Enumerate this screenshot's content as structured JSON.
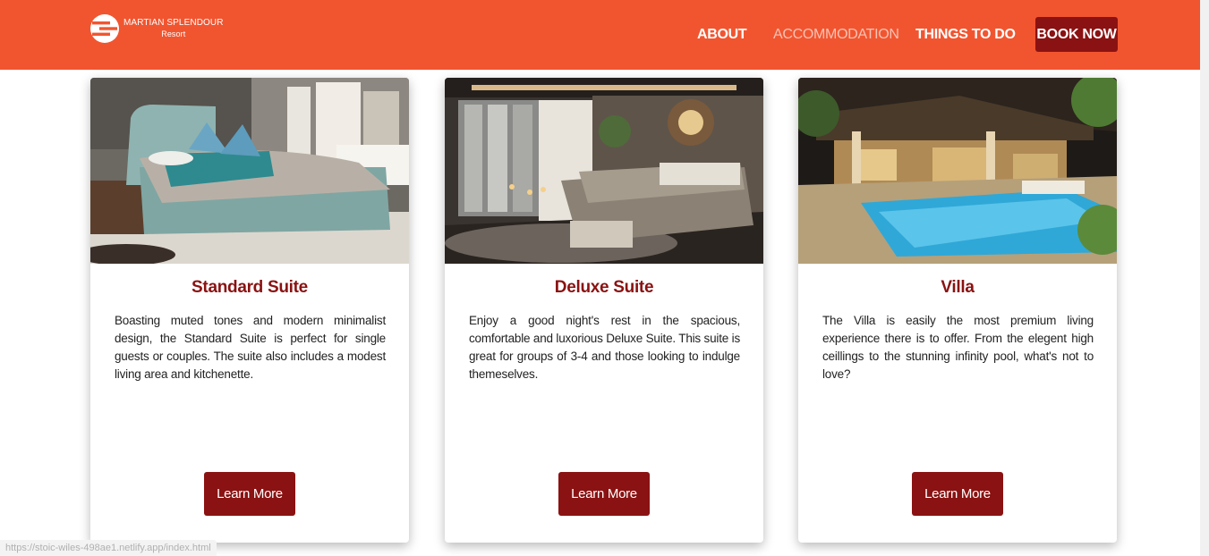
{
  "brand": {
    "name": "MARTIAN SPLENDOUR",
    "sub": "Resort"
  },
  "nav": {
    "items": [
      {
        "label": "ABOUT",
        "active": false
      },
      {
        "label": "ACCOMMODATION",
        "active": true
      },
      {
        "label": "THINGS TO DO",
        "active": false
      }
    ],
    "cta": "BOOK NOW"
  },
  "colors": {
    "header": "#f15530",
    "accent": "#8a1212",
    "nav_active": "#f7c2b4"
  },
  "cards": [
    {
      "title": "Standard Suite",
      "description": "Boasting muted tones and modern minimalist design, the Standard Suite is perfect for single guests or couples. The suite also includes a modest living area and kitchenette.",
      "button": "Learn More",
      "image": "standard-suite-bedroom-photo"
    },
    {
      "title": "Deluxe Suite",
      "description": "Enjoy a good night's rest in the spacious, comfortable and luxorious Deluxe Suite. This suite is great for groups of 3-4 and those looking to indulge themeselves.",
      "button": "Learn More",
      "image": "deluxe-suite-bedroom-photo"
    },
    {
      "title": "Villa",
      "description": "The Villa is easily the most premium living experience there is to offer. From the elegent high ceillings to the stunning infinity pool, what's not to love?",
      "button": "Learn More",
      "image": "villa-pool-photo"
    }
  ],
  "status_bar": {
    "url": "https://stoic-wiles-498ae1.netlify.app/index.html"
  }
}
